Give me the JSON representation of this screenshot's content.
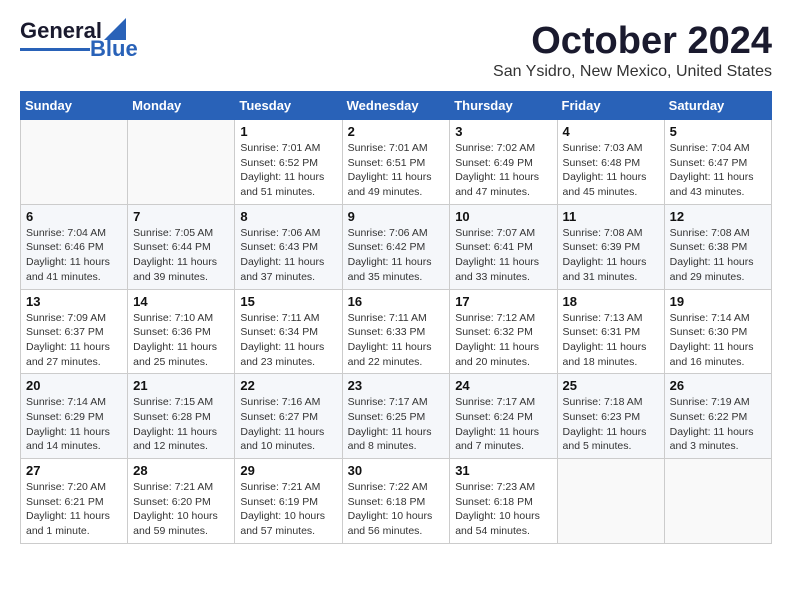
{
  "header": {
    "logo": {
      "line1": "General",
      "line2": "Blue"
    },
    "title": "October 2024",
    "location": "San Ysidro, New Mexico, United States"
  },
  "days_of_week": [
    "Sunday",
    "Monday",
    "Tuesday",
    "Wednesday",
    "Thursday",
    "Friday",
    "Saturday"
  ],
  "weeks": [
    [
      {
        "day": "",
        "info": ""
      },
      {
        "day": "",
        "info": ""
      },
      {
        "day": "1",
        "info": "Sunrise: 7:01 AM\nSunset: 6:52 PM\nDaylight: 11 hours and 51 minutes."
      },
      {
        "day": "2",
        "info": "Sunrise: 7:01 AM\nSunset: 6:51 PM\nDaylight: 11 hours and 49 minutes."
      },
      {
        "day": "3",
        "info": "Sunrise: 7:02 AM\nSunset: 6:49 PM\nDaylight: 11 hours and 47 minutes."
      },
      {
        "day": "4",
        "info": "Sunrise: 7:03 AM\nSunset: 6:48 PM\nDaylight: 11 hours and 45 minutes."
      },
      {
        "day": "5",
        "info": "Sunrise: 7:04 AM\nSunset: 6:47 PM\nDaylight: 11 hours and 43 minutes."
      }
    ],
    [
      {
        "day": "6",
        "info": "Sunrise: 7:04 AM\nSunset: 6:46 PM\nDaylight: 11 hours and 41 minutes."
      },
      {
        "day": "7",
        "info": "Sunrise: 7:05 AM\nSunset: 6:44 PM\nDaylight: 11 hours and 39 minutes."
      },
      {
        "day": "8",
        "info": "Sunrise: 7:06 AM\nSunset: 6:43 PM\nDaylight: 11 hours and 37 minutes."
      },
      {
        "day": "9",
        "info": "Sunrise: 7:06 AM\nSunset: 6:42 PM\nDaylight: 11 hours and 35 minutes."
      },
      {
        "day": "10",
        "info": "Sunrise: 7:07 AM\nSunset: 6:41 PM\nDaylight: 11 hours and 33 minutes."
      },
      {
        "day": "11",
        "info": "Sunrise: 7:08 AM\nSunset: 6:39 PM\nDaylight: 11 hours and 31 minutes."
      },
      {
        "day": "12",
        "info": "Sunrise: 7:08 AM\nSunset: 6:38 PM\nDaylight: 11 hours and 29 minutes."
      }
    ],
    [
      {
        "day": "13",
        "info": "Sunrise: 7:09 AM\nSunset: 6:37 PM\nDaylight: 11 hours and 27 minutes."
      },
      {
        "day": "14",
        "info": "Sunrise: 7:10 AM\nSunset: 6:36 PM\nDaylight: 11 hours and 25 minutes."
      },
      {
        "day": "15",
        "info": "Sunrise: 7:11 AM\nSunset: 6:34 PM\nDaylight: 11 hours and 23 minutes."
      },
      {
        "day": "16",
        "info": "Sunrise: 7:11 AM\nSunset: 6:33 PM\nDaylight: 11 hours and 22 minutes."
      },
      {
        "day": "17",
        "info": "Sunrise: 7:12 AM\nSunset: 6:32 PM\nDaylight: 11 hours and 20 minutes."
      },
      {
        "day": "18",
        "info": "Sunrise: 7:13 AM\nSunset: 6:31 PM\nDaylight: 11 hours and 18 minutes."
      },
      {
        "day": "19",
        "info": "Sunrise: 7:14 AM\nSunset: 6:30 PM\nDaylight: 11 hours and 16 minutes."
      }
    ],
    [
      {
        "day": "20",
        "info": "Sunrise: 7:14 AM\nSunset: 6:29 PM\nDaylight: 11 hours and 14 minutes."
      },
      {
        "day": "21",
        "info": "Sunrise: 7:15 AM\nSunset: 6:28 PM\nDaylight: 11 hours and 12 minutes."
      },
      {
        "day": "22",
        "info": "Sunrise: 7:16 AM\nSunset: 6:27 PM\nDaylight: 11 hours and 10 minutes."
      },
      {
        "day": "23",
        "info": "Sunrise: 7:17 AM\nSunset: 6:25 PM\nDaylight: 11 hours and 8 minutes."
      },
      {
        "day": "24",
        "info": "Sunrise: 7:17 AM\nSunset: 6:24 PM\nDaylight: 11 hours and 7 minutes."
      },
      {
        "day": "25",
        "info": "Sunrise: 7:18 AM\nSunset: 6:23 PM\nDaylight: 11 hours and 5 minutes."
      },
      {
        "day": "26",
        "info": "Sunrise: 7:19 AM\nSunset: 6:22 PM\nDaylight: 11 hours and 3 minutes."
      }
    ],
    [
      {
        "day": "27",
        "info": "Sunrise: 7:20 AM\nSunset: 6:21 PM\nDaylight: 11 hours and 1 minute."
      },
      {
        "day": "28",
        "info": "Sunrise: 7:21 AM\nSunset: 6:20 PM\nDaylight: 10 hours and 59 minutes."
      },
      {
        "day": "29",
        "info": "Sunrise: 7:21 AM\nSunset: 6:19 PM\nDaylight: 10 hours and 57 minutes."
      },
      {
        "day": "30",
        "info": "Sunrise: 7:22 AM\nSunset: 6:18 PM\nDaylight: 10 hours and 56 minutes."
      },
      {
        "day": "31",
        "info": "Sunrise: 7:23 AM\nSunset: 6:18 PM\nDaylight: 10 hours and 54 minutes."
      },
      {
        "day": "",
        "info": ""
      },
      {
        "day": "",
        "info": ""
      }
    ]
  ]
}
